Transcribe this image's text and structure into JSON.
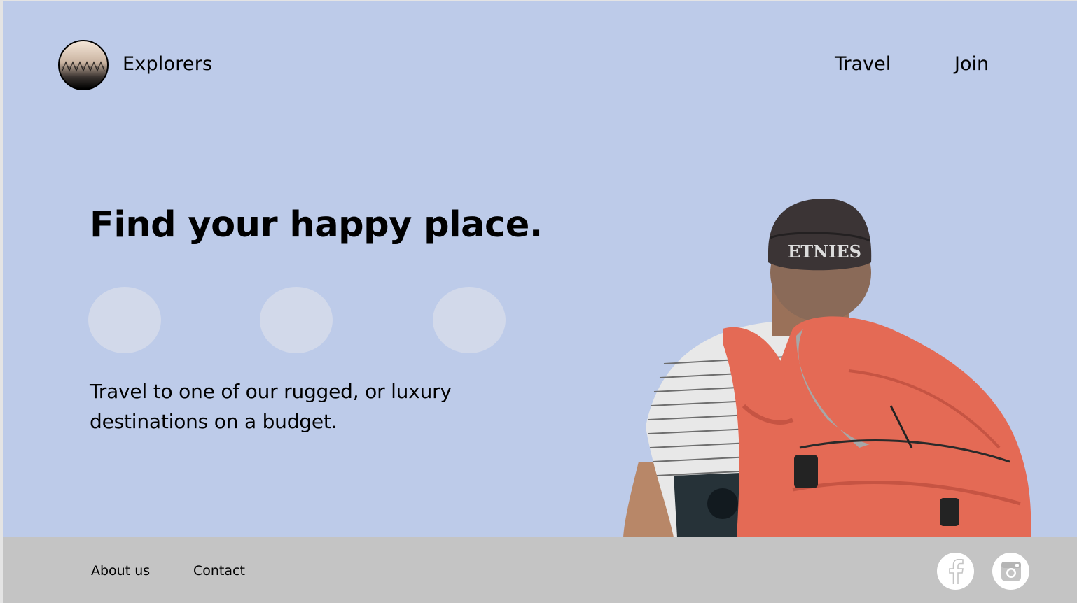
{
  "header": {
    "brand": "Explorers",
    "nav": [
      {
        "label": "Travel"
      },
      {
        "label": "Join"
      }
    ]
  },
  "hero": {
    "headline": "Find your happy place.",
    "tagline": "Travel to one of our rugged, or luxury destinations on a budget.",
    "image_alt": "Hiker with orange backpack"
  },
  "footer": {
    "links": [
      {
        "label": "About us"
      },
      {
        "label": "Contact"
      }
    ],
    "social": [
      {
        "icon": "facebook-icon"
      },
      {
        "icon": "instagram-icon"
      }
    ]
  },
  "colors": {
    "background": "#bdcbe9",
    "footer": "#c4c4c4",
    "pill": "#d2d9ea",
    "backpack": "#e46a55",
    "text": "#000000"
  }
}
